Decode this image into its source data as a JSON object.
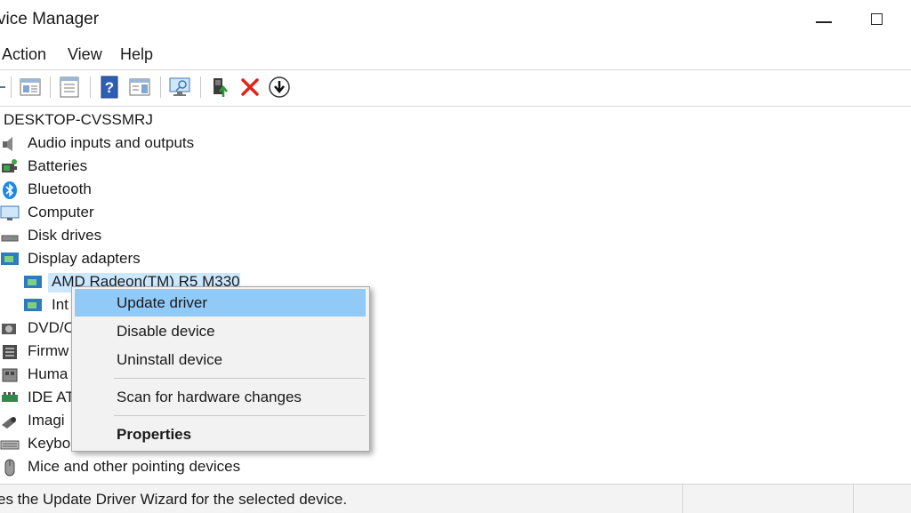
{
  "window": {
    "title": "vice Manager"
  },
  "menu": [
    "Action",
    "View",
    "Help"
  ],
  "toolbar": {
    "icons": [
      "back-icon",
      "show-hide-tree-icon",
      "properties-icon",
      "help-icon",
      "action-pane-icon",
      "scan-hardware-icon",
      "update-driver-icon",
      "uninstall-icon",
      "download-icon"
    ]
  },
  "tree": {
    "root": "DESKTOP-CVSSMRJ",
    "categories": {
      "audio": "Audio inputs and outputs",
      "batteries": "Batteries",
      "bluetooth": "Bluetooth",
      "computer": "Computer",
      "disk": "Disk drives",
      "display": "Display adapters",
      "display_child_1": "AMD Radeon(TM) R5 M330",
      "display_child_2": "Int",
      "dvd": "DVD/C",
      "firmware": "Firmw",
      "hid": "Huma",
      "ide": "IDE AT",
      "imaging": "Imagi",
      "keyboards": "Keybo",
      "mice": "Mice and other pointing devices"
    }
  },
  "context_menu": {
    "update": "Update driver",
    "disable": "Disable device",
    "uninstall": "Uninstall device",
    "scan": "Scan for hardware changes",
    "properties": "Properties"
  },
  "status": {
    "text": "es the Update Driver Wizard for the selected device."
  },
  "colors": {
    "highlight": "#91c9f7",
    "selection": "#cce8ff",
    "accent_blue": "#1e88e5"
  }
}
